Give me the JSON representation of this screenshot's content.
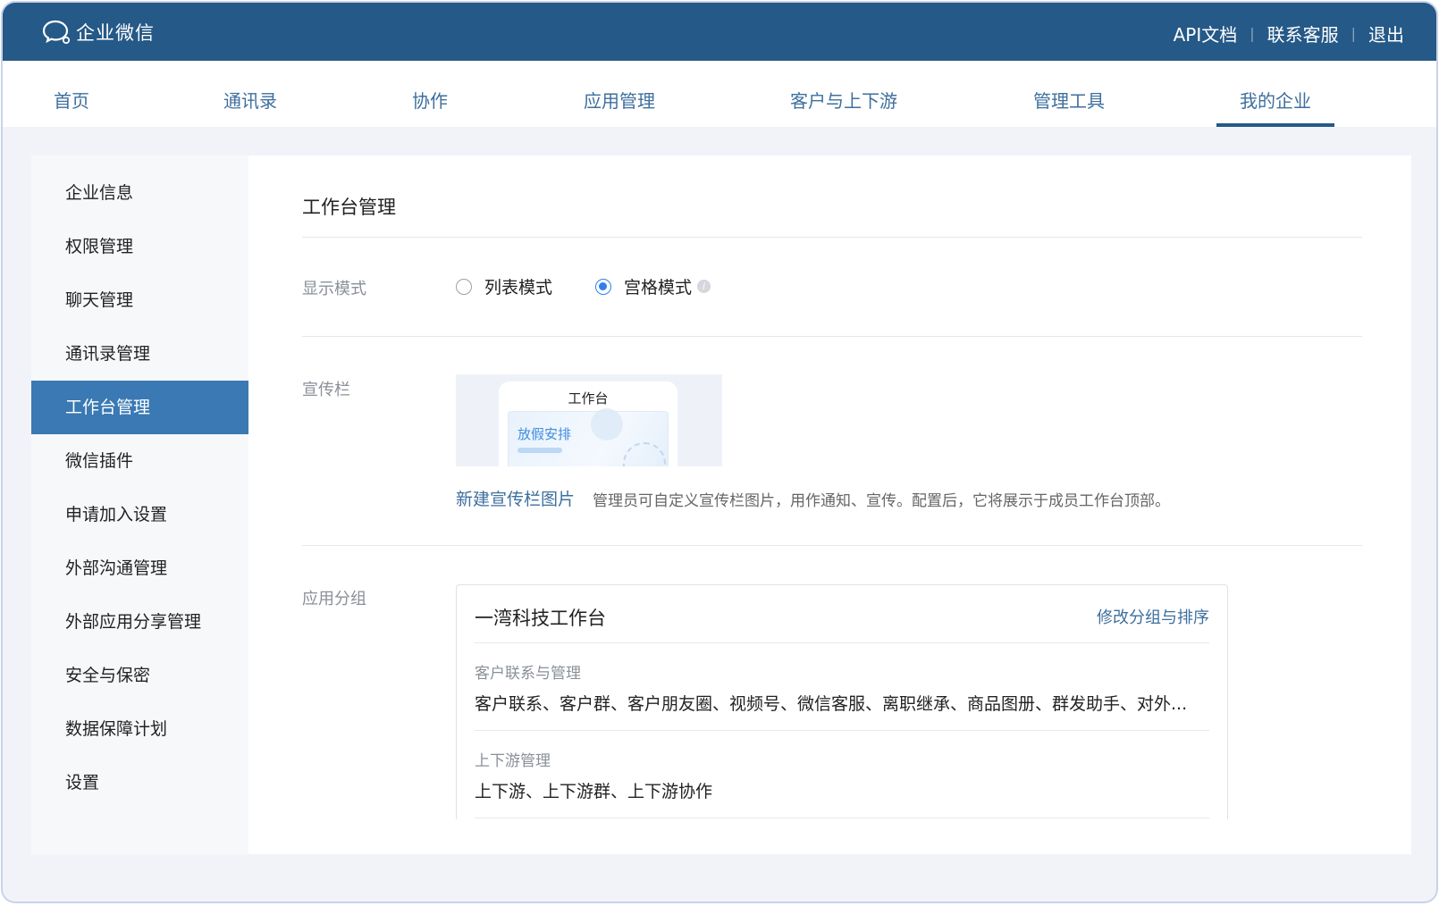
{
  "header": {
    "app_name": "企业微信",
    "links": [
      {
        "label": "API文档"
      },
      {
        "label": "联系客服"
      },
      {
        "label": "退出"
      }
    ]
  },
  "nav": {
    "tabs": [
      {
        "label": "首页"
      },
      {
        "label": "通讯录"
      },
      {
        "label": "协作"
      },
      {
        "label": "应用管理"
      },
      {
        "label": "客户与上下游"
      },
      {
        "label": "管理工具"
      },
      {
        "label": "我的企业",
        "active": true
      }
    ]
  },
  "sidebar": {
    "items": [
      {
        "label": "企业信息"
      },
      {
        "label": "权限管理"
      },
      {
        "label": "聊天管理"
      },
      {
        "label": "通讯录管理"
      },
      {
        "label": "工作台管理",
        "active": true
      },
      {
        "label": "微信插件"
      },
      {
        "label": "申请加入设置"
      },
      {
        "label": "外部沟通管理"
      },
      {
        "label": "外部应用分享管理"
      },
      {
        "label": "安全与保密"
      },
      {
        "label": "数据保障计划"
      },
      {
        "label": "设置"
      }
    ]
  },
  "main": {
    "title": "工作台管理",
    "display_mode": {
      "label": "显示模式",
      "options": [
        {
          "label": "列表模式",
          "checked": false
        },
        {
          "label": "宫格模式",
          "checked": true
        }
      ],
      "info_icon": "i"
    },
    "banner": {
      "label": "宣传栏",
      "preview_title": "工作台",
      "preview_card_text": "放假安排",
      "new_link": "新建宣传栏图片",
      "description": "管理员可自定义宣传栏图片，用作通知、宣传。配置后，它将展示于成员工作台顶部。"
    },
    "app_groups": {
      "label": "应用分组",
      "workspace_title": "一湾科技工作台",
      "edit_link": "修改分组与排序",
      "categories": [
        {
          "name": "客户联系与管理",
          "apps": "客户联系、客户群、客户朋友圈、视频号、微信客服、离职继承、商品图册、群发助手、对外..."
        },
        {
          "name": "上下游管理",
          "apps": "上下游、上下游群、上下游协作"
        }
      ]
    }
  },
  "colors": {
    "header_bg": "#255987",
    "accent": "#3a79b3",
    "link": "#3e6f9e",
    "radio_checked": "#2f80ed"
  }
}
